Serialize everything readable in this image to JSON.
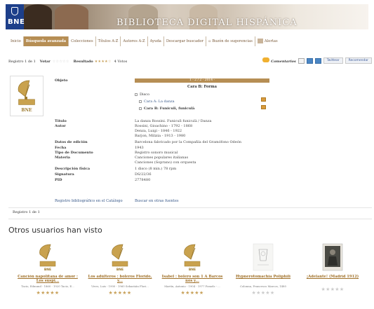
{
  "banner": {
    "logo_text": "BNE",
    "title": "BIBLIOTECA DIGITAL HISPÁNICA"
  },
  "nav": {
    "items": [
      {
        "label": "Inicio",
        "active": false
      },
      {
        "label": "Búsqueda avanzada",
        "active": true
      },
      {
        "label": "Colecciones",
        "active": false
      },
      {
        "label": "Títulos A-Z",
        "active": false
      },
      {
        "label": "Autores A-Z",
        "active": false
      },
      {
        "label": "Ayuda",
        "active": false
      },
      {
        "label": "Descargar buscador",
        "active": false
      },
      {
        "label": "Buzón de sugerencias",
        "active": false
      },
      {
        "label": "Alertas",
        "active": false
      }
    ]
  },
  "toolbar": {
    "records": "Registro 1 de 1",
    "vote_label": "Votar",
    "vote_stars": "☆☆☆☆☆",
    "result_label": "Resultado",
    "result_stars": "★★★★☆",
    "votes": "4 Votos",
    "comments_label": "Comentarios",
    "twitter_label": "Twittear",
    "facebook_label": "Recomendar"
  },
  "record": {
    "thumb_label": "BNE",
    "fields": [
      {
        "label": "Objeto",
        "value": ""
      },
      {
        "label": "Título",
        "value": "La danza Rossini. Funiculì funiculà / Danza"
      },
      {
        "label": "Autor",
        "value": "Rossini, Gioachino - 1792 - 1868"
      },
      {
        "label": "",
        "value": "Denza, Luigi - 1846 - 1922"
      },
      {
        "label": "",
        "value": "Barjon, Milizia - 1913 - 1980"
      },
      {
        "label": "Datos de edición",
        "value": "Barcelona fabricado por la Compañía del Gramófono Odeón"
      },
      {
        "label": "Fecha",
        "value": "1943"
      },
      {
        "label": "Tipo de Documento",
        "value": "Registro sonoro musical"
      },
      {
        "label": "Materia",
        "value": "Canciones populares italianas"
      },
      {
        "label": "",
        "value": "Canciones (Soprano) con orquesta"
      },
      {
        "label": "Descripción física",
        "value": "1 disco (8 min.) 78 rpm"
      },
      {
        "label": "Signatura",
        "value": "DS/22/36"
      },
      {
        "label": "PID",
        "value": "2778480"
      }
    ],
    "tree": {
      "head": "1 - 2 / 2 - 2014 -",
      "title": "Cara B: Forma",
      "items": [
        "Disco",
        "Cara A: La danza",
        "Cara B: Funiculì, funiculà"
      ]
    },
    "links": [
      "Registro bibliográfico en el Catálogo",
      "Buscar en otras fuentes"
    ],
    "records_bottom": "Registro 1 de 1"
  },
  "related": {
    "title": "Otros usuarios han visto",
    "items": [
      {
        "title": "Canción napolitana de amor : Los suspi...",
        "meta": "Tacio, Edmund - 1860 - 1920 Tacio, E...",
        "stars": "★★★★★",
        "rated": true,
        "kind": "gramophone"
      },
      {
        "title": "Los adúlteros : boleros Florido, y...",
        "meta": "Vives, Luis - 1900 - 1960 Sebastián Flori...",
        "stars": "★★★★★",
        "rated": true,
        "kind": "gramophone"
      },
      {
        "title": "Isabel : bolero son 1 A Barcos nos y...",
        "meta": "Martín, Antonio - 1904 - 1977 Fomels - ...",
        "stars": "★★★★★",
        "rated": true,
        "kind": "gramophone"
      },
      {
        "title": "Hypnerotomachia Poliphili",
        "meta": "Colonna, Francesco Marcos, 1480",
        "stars": "★★★★★",
        "rated": false,
        "kind": "print"
      },
      {
        "title": "¡Adelante! (Madrid 1912)",
        "meta": "",
        "stars": "★★★★★",
        "rated": false,
        "kind": "photo"
      }
    ]
  },
  "colors": {
    "accent": "#b68e54",
    "link": "#3a5a8a",
    "star": "#c8a15a",
    "bne_blue": "#1d3f8a"
  }
}
